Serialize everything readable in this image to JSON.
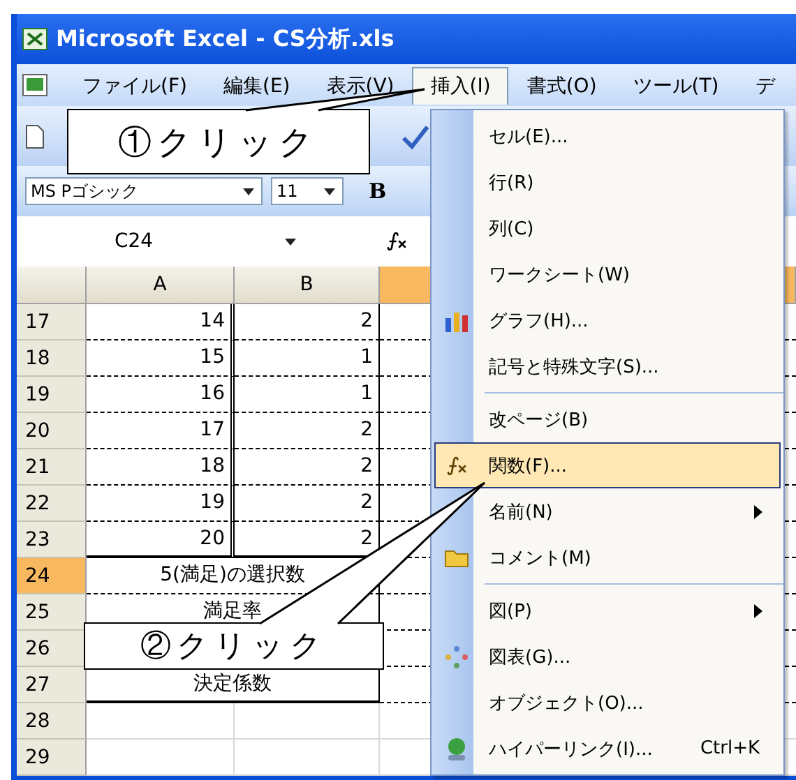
{
  "window": {
    "title": "Microsoft Excel - CS分析.xls"
  },
  "menubar": [
    {
      "label": "ファイル(F)",
      "selected": false
    },
    {
      "label": "編集(E)",
      "selected": false
    },
    {
      "label": "表示(V)",
      "selected": false
    },
    {
      "label": "挿入(I)",
      "selected": true
    },
    {
      "label": "書式(O)",
      "selected": false
    },
    {
      "label": "ツール(T)",
      "selected": false
    },
    {
      "label": "デ",
      "selected": false
    }
  ],
  "format_toolbar": {
    "font": "MS Pゴシック",
    "size": "11",
    "bold": "B"
  },
  "formula_bar": {
    "name_box": "C24"
  },
  "sheet": {
    "columns": [
      {
        "label": "A",
        "selected": false
      },
      {
        "label": "B",
        "selected": false
      },
      {
        "selected": true
      }
    ],
    "rows": [
      {
        "header": "17",
        "selected": false,
        "kind": "pair",
        "cells": [
          "14",
          "2"
        ]
      },
      {
        "header": "18",
        "selected": false,
        "kind": "pair",
        "cells": [
          "15",
          "1"
        ]
      },
      {
        "header": "19",
        "selected": false,
        "kind": "pair",
        "cells": [
          "16",
          "1"
        ]
      },
      {
        "header": "20",
        "selected": false,
        "kind": "pair",
        "cells": [
          "17",
          "2"
        ]
      },
      {
        "header": "21",
        "selected": false,
        "kind": "pair",
        "cells": [
          "18",
          "2"
        ]
      },
      {
        "header": "22",
        "selected": false,
        "kind": "pair",
        "cells": [
          "19",
          "2"
        ]
      },
      {
        "header": "23",
        "selected": false,
        "kind": "pair",
        "cells": [
          "20",
          "2"
        ]
      },
      {
        "header": "24",
        "selected": true,
        "kind": "merged",
        "text": "5(満足)の選択数"
      },
      {
        "header": "25",
        "selected": false,
        "kind": "merged",
        "text": "満足率"
      },
      {
        "header": "26",
        "selected": false,
        "kind": "merged"
      },
      {
        "header": "27",
        "selected": false,
        "kind": "merged",
        "text": "決定係数"
      },
      {
        "header": "28",
        "selected": false,
        "kind": "blank"
      },
      {
        "header": "29",
        "selected": false,
        "kind": "blank"
      }
    ]
  },
  "insert_menu": [
    {
      "label": "セル(E)...",
      "kind": "plain",
      "selected": false
    },
    {
      "label": "行(R)",
      "kind": "plain",
      "selected": false
    },
    {
      "label": "列(C)",
      "kind": "plain",
      "selected": false
    },
    {
      "label": "ワークシート(W)",
      "kind": "plain",
      "selected": false
    },
    {
      "label": "グラフ(H)...",
      "kind": "chart",
      "selected": false
    },
    {
      "label": "記号と特殊文字(S)...",
      "kind": "plain",
      "selected": false
    },
    {
      "label": "改ページ(B)",
      "kind": "plain",
      "selected": false,
      "separator_before": true
    },
    {
      "label": "関数(F)...",
      "kind": "function",
      "selected": true
    },
    {
      "label": "名前(N)",
      "kind": "plain",
      "selected": false,
      "submenu": true
    },
    {
      "label": "コメント(M)",
      "kind": "comment",
      "selected": false
    },
    {
      "label": "図(P)",
      "kind": "plain",
      "selected": false,
      "submenu": true,
      "separator_before": true
    },
    {
      "label": "図表(G)...",
      "kind": "diagram",
      "selected": false
    },
    {
      "label": "オブジェクト(O)...",
      "kind": "plain",
      "selected": false
    },
    {
      "label": "ハイパーリンク(I)...",
      "kind": "hyperlink",
      "selected": false,
      "shortcut": "Ctrl+K"
    }
  ],
  "callouts": [
    {
      "text": "①クリック"
    },
    {
      "text": "②クリック"
    }
  ]
}
